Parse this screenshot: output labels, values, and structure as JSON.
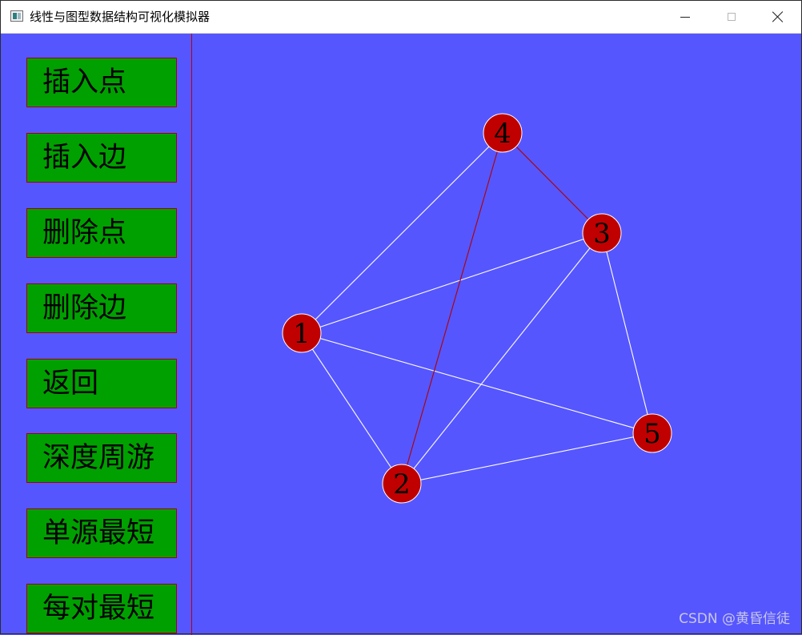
{
  "window": {
    "title": "线性与图型数据结构可视化模拟器"
  },
  "sidebar": {
    "buttons": [
      {
        "label": "插入点"
      },
      {
        "label": "插入边"
      },
      {
        "label": "删除点"
      },
      {
        "label": "删除边"
      },
      {
        "label": "返回"
      },
      {
        "label": "深度周游"
      },
      {
        "label": "单源最短"
      },
      {
        "label": "每对最短"
      }
    ]
  },
  "graph": {
    "colors": {
      "node_fill": "#c00000",
      "node_stroke": "#ffffff",
      "edge_default": "#ffffff",
      "edge_highlight": "#b00000",
      "background": "#5656ff"
    },
    "nodes": [
      {
        "id": "1",
        "label": "1"
      },
      {
        "id": "2",
        "label": "2"
      },
      {
        "id": "3",
        "label": "3"
      },
      {
        "id": "4",
        "label": "4"
      },
      {
        "id": "5",
        "label": "5"
      }
    ],
    "edges": [
      {
        "from": "1",
        "to": "4",
        "highlight": false
      },
      {
        "from": "1",
        "to": "3",
        "highlight": false
      },
      {
        "from": "1",
        "to": "2",
        "highlight": false
      },
      {
        "from": "1",
        "to": "5",
        "highlight": false
      },
      {
        "from": "2",
        "to": "4",
        "highlight": true
      },
      {
        "from": "2",
        "to": "3",
        "highlight": false
      },
      {
        "from": "2",
        "to": "5",
        "highlight": false
      },
      {
        "from": "3",
        "to": "4",
        "highlight": true
      },
      {
        "from": "3",
        "to": "5",
        "highlight": false
      }
    ]
  },
  "watermark": "CSDN @黄昏信徒"
}
